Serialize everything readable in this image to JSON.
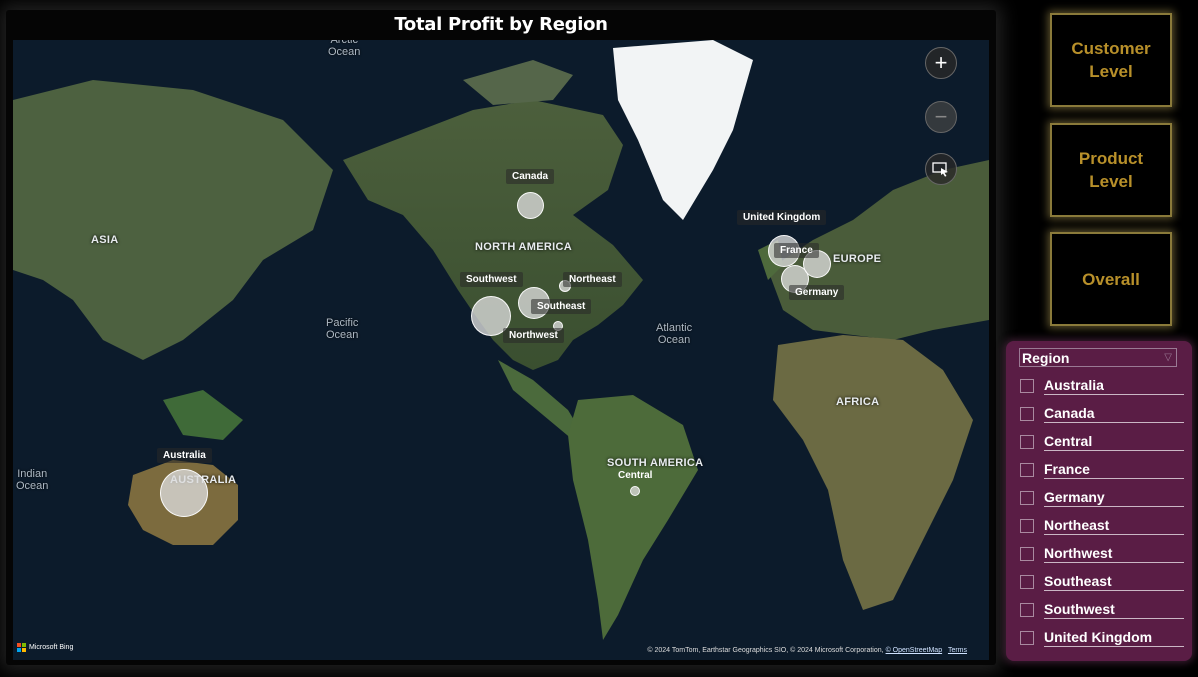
{
  "visual": {
    "title": "Total Profit by Region"
  },
  "map": {
    "ocean_labels": [
      {
        "text": "Arctic\nOcean"
      },
      {
        "text": "Pacific\nOcean"
      },
      {
        "text": "Atlantic\nOcean"
      },
      {
        "text": "Indian\nOcean"
      }
    ],
    "continent_labels": [
      "ASIA",
      "NORTH AMERICA",
      "EUROPE",
      "AFRICA",
      "SOUTH AMERICA",
      "AUSTRALIA"
    ],
    "regions": [
      {
        "name": "Canada"
      },
      {
        "name": "United Kingdom"
      },
      {
        "name": "France"
      },
      {
        "name": "Germany"
      },
      {
        "name": "Southwest"
      },
      {
        "name": "Northeast"
      },
      {
        "name": "Southeast"
      },
      {
        "name": "Northwest"
      },
      {
        "name": "Australia"
      },
      {
        "name": "Central"
      }
    ],
    "controls": {
      "zoom_in": "+",
      "zoom_out": "−"
    },
    "bing_label": "Microsoft Bing",
    "attribution": "© 2024 TomTom, Earthstar Geographics SIO, © 2024 Microsoft Corporation,",
    "attribution_link": "© OpenStreetMap",
    "terms_link": "Terms"
  },
  "nav_buttons": [
    {
      "label": "Customer\nLevel"
    },
    {
      "label": "Product\nLevel"
    },
    {
      "label": "Overall"
    }
  ],
  "slicer": {
    "title": "Region",
    "items": [
      "Australia",
      "Canada",
      "Central",
      "France",
      "Germany",
      "Northeast",
      "Northwest",
      "Southeast",
      "Southwest",
      "United Kingdom"
    ]
  },
  "colors": {
    "nav_text": "#b8902a",
    "slicer_bg": "#5a1d45",
    "ocean": "#0c1b2b",
    "land": "#3f5a34"
  }
}
